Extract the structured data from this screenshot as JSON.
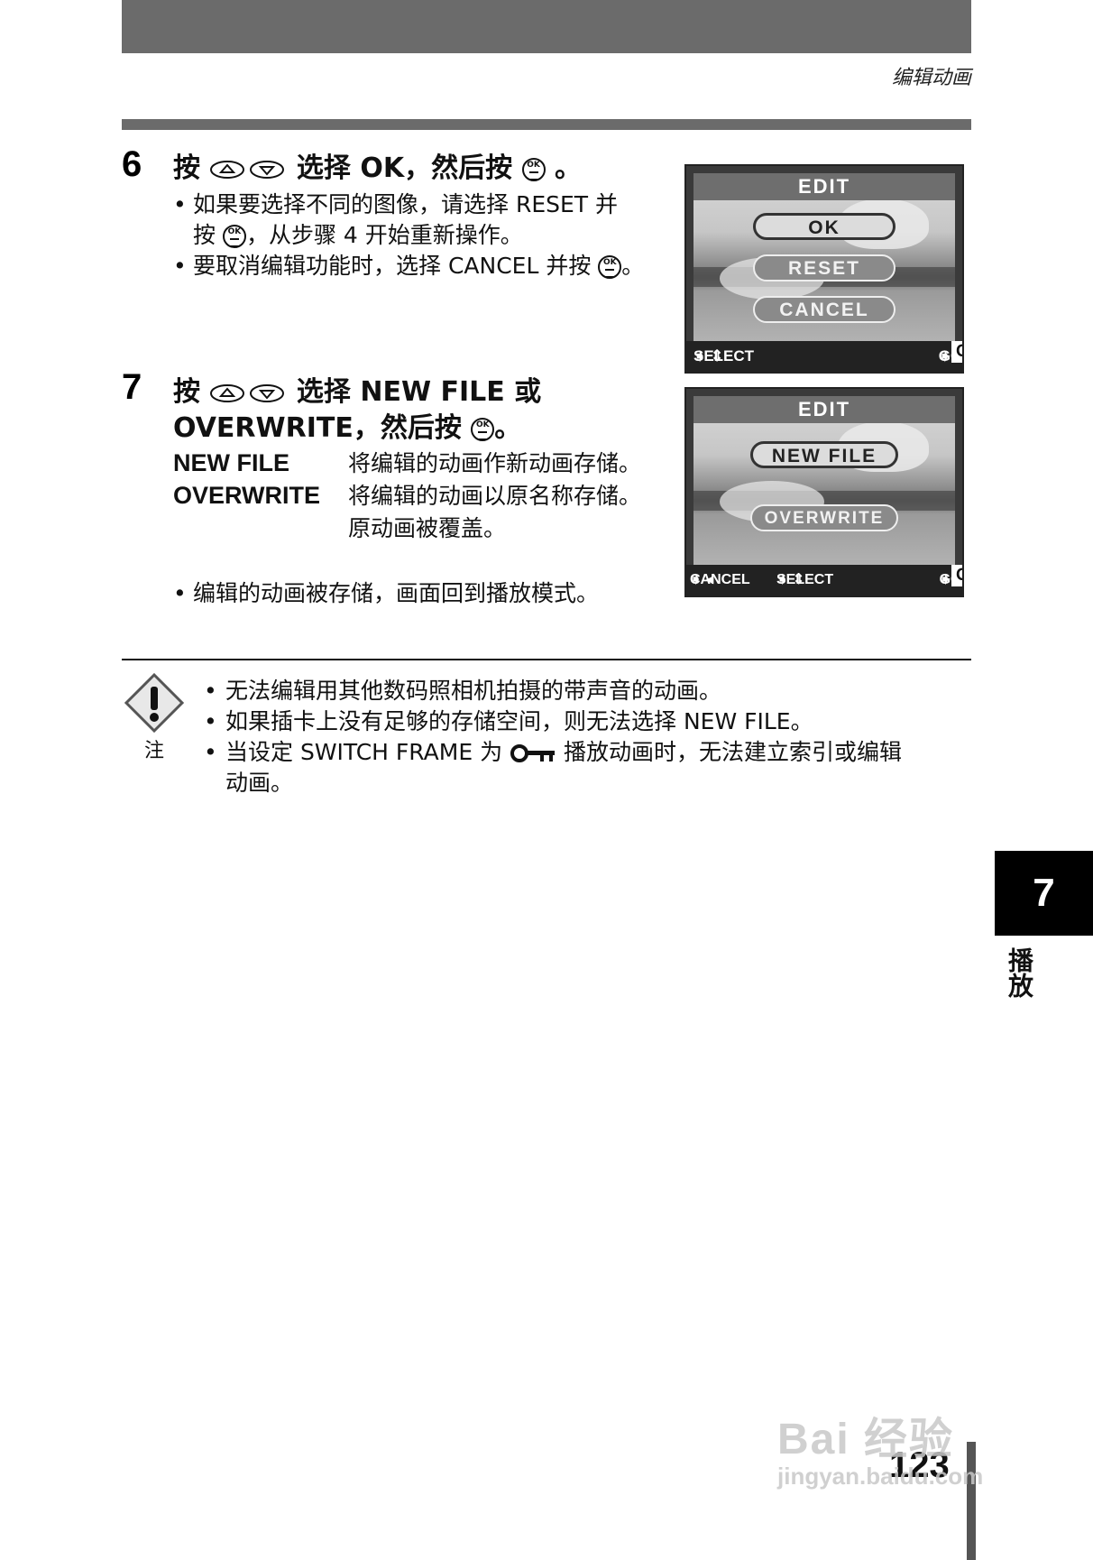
{
  "header": {
    "section_title": "编辑动画"
  },
  "step6": {
    "number": "6",
    "instruction_prefix": "按",
    "instruction_mid": "选择 OK，然后按",
    "instruction_suffix": "。",
    "bullet1_line1": "如果要选择不同的图像，请选择 RESET 并",
    "bullet1_line2_pre": "按",
    "bullet1_line2_post": "，从步骤 4 开始重新操作。",
    "bullet2_pre": "要取消编辑功能时，选择 CANCEL 并按",
    "bullet2_post": "。"
  },
  "screen1": {
    "title": "EDIT",
    "buttons": [
      "OK",
      "RESET",
      "CANCEL"
    ],
    "selected": "OK",
    "bar_left": "SELECT",
    "bar_right_go": "GO",
    "bar_right_ok": "OK"
  },
  "step7": {
    "number": "7",
    "line1_prefix": "按",
    "line1_mid": "选择 NEW FILE 或",
    "line2_pre": "OVERWRITE，然后按",
    "line2_post": "。",
    "defs": [
      {
        "key": "NEW FILE",
        "value": "将编辑的动画作新动画存储。"
      },
      {
        "key": "OVERWRITE",
        "value": "将编辑的动画以原名称存储。"
      },
      {
        "key": "",
        "value": "原动画被覆盖。"
      }
    ],
    "bullet": "编辑的动画被存储，画面回到播放模式。"
  },
  "screen2": {
    "title": "EDIT",
    "buttons": [
      "NEW FILE",
      "OVERWRITE"
    ],
    "selected": "NEW FILE",
    "bar_cancel": "CANCEL",
    "bar_select": "SELECT",
    "bar_go": "GO",
    "bar_ok": "OK"
  },
  "note": {
    "label": "注",
    "items": [
      "无法编辑用其他数码照相机拍摄的带声音的动画。",
      "如果插卡上没有足够的存储空间，则无法选择 NEW FILE。"
    ],
    "item3_pre": "当设定 SWITCH FRAME 为",
    "item3_post": "播放动画时，无法建立索引或编辑",
    "item3_line2": "动画。"
  },
  "chapter": {
    "number": "7",
    "label": "播放"
  },
  "page_number": "123",
  "watermark": {
    "line1": "Bai 经验",
    "line2": "jingyan.baidu.com"
  }
}
